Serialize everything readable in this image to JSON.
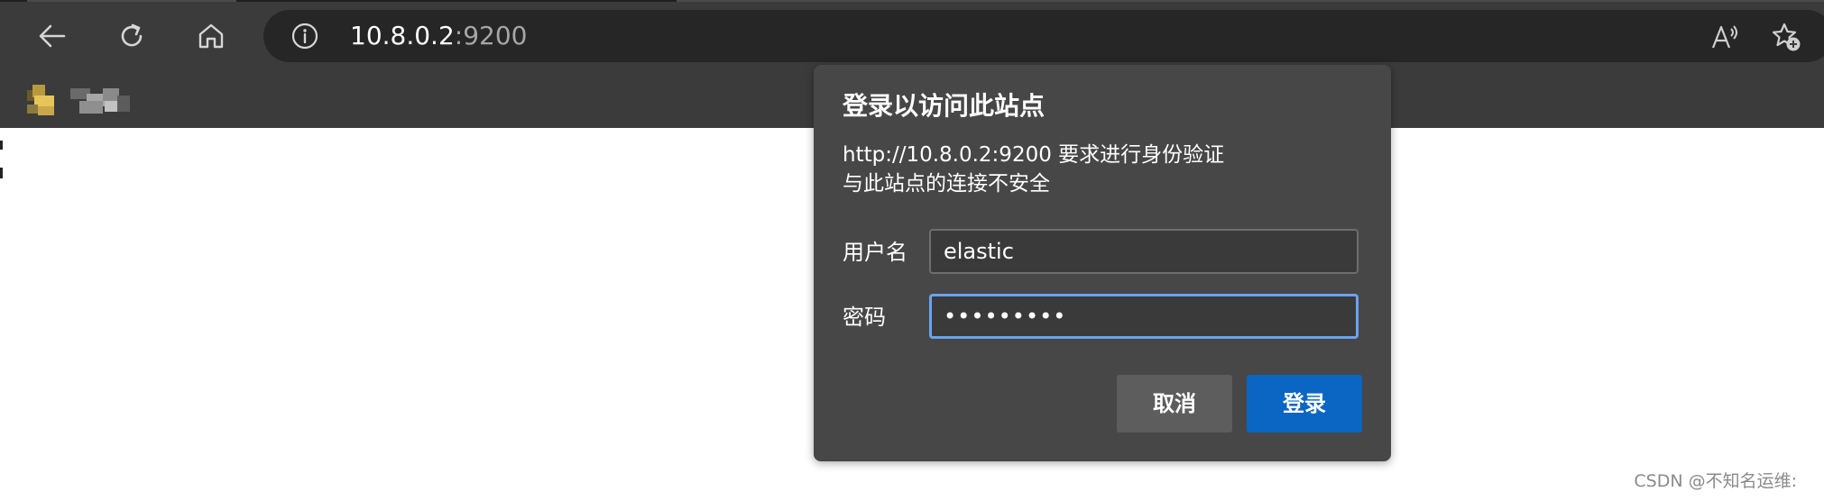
{
  "browser": {
    "address_bar": {
      "host": "10.8.0.2",
      "port": ":9200"
    },
    "icons": {
      "back": "back-arrow-icon",
      "refresh": "refresh-icon",
      "home": "home-icon",
      "site_info": "info-icon",
      "read_aloud": "read-aloud-icon",
      "add_favorite": "add-favorite-icon"
    }
  },
  "auth_dialog": {
    "title": "登录以访问此站点",
    "message_line1": "http://10.8.0.2:9200 要求进行身份验证",
    "message_line2": "与此站点的连接不安全",
    "username_label": "用户名",
    "username_value": "elastic",
    "password_label": "密码",
    "password_value": "•••••••••",
    "cancel_label": "取消",
    "login_label": "登录"
  },
  "watermark": "CSDN @不知名运维:",
  "colors": {
    "toolbar": "#3b3b3b",
    "address_bar": "#262626",
    "dialog": "#474747",
    "primary_button": "#0a66c2",
    "focus_ring": "#6aa3f0"
  }
}
